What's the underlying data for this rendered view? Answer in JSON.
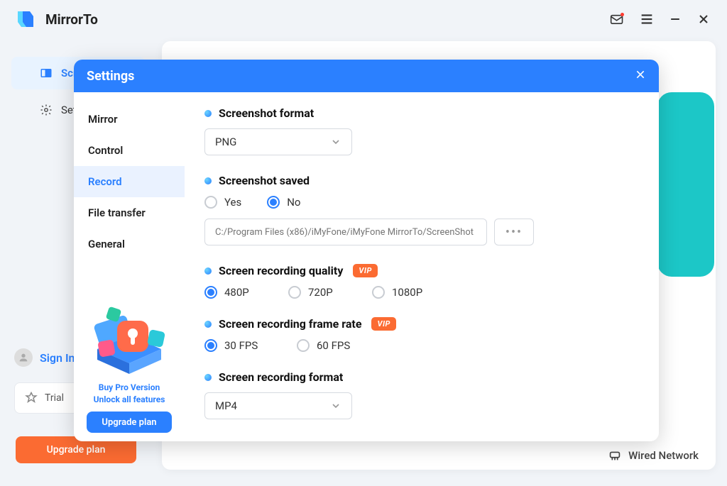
{
  "app": {
    "name": "MirrorTo"
  },
  "leftnav": {
    "items": [
      {
        "label": "Screen Mirror",
        "active": true
      },
      {
        "label": "Settings",
        "active": false
      }
    ]
  },
  "signin": {
    "label": "Sign In"
  },
  "trial": {
    "label": "Trial"
  },
  "footer_upgrade": "Upgrade plan",
  "wired": {
    "label": "Wired Network"
  },
  "modal": {
    "title": "Settings",
    "nav": [
      {
        "label": "Mirror"
      },
      {
        "label": "Control"
      },
      {
        "label": "Record",
        "active": true
      },
      {
        "label": "File transfer"
      },
      {
        "label": "General"
      }
    ],
    "promo": {
      "line1": "Buy Pro Version",
      "line2": "Unlock all features",
      "button": "Upgrade plan"
    }
  },
  "settings": {
    "screenshot_format": {
      "label": "Screenshot format",
      "value": "PNG"
    },
    "screenshot_saved": {
      "label": "Screenshot saved",
      "options": [
        "Yes",
        "No"
      ],
      "selected": "No",
      "path_placeholder": "C:/Program Files (x86)/iMyFone/iMyFone MirrorTo/ScreenShot"
    },
    "recording_quality": {
      "label": "Screen recording quality",
      "vip": "VIP",
      "options": [
        "480P",
        "720P",
        "1080P"
      ],
      "selected": "480P"
    },
    "recording_fps": {
      "label": "Screen recording frame rate",
      "vip": "VIP",
      "options": [
        "30 FPS",
        "60 FPS"
      ],
      "selected": "30 FPS"
    },
    "recording_format": {
      "label": "Screen recording format",
      "value": "MP4"
    }
  }
}
